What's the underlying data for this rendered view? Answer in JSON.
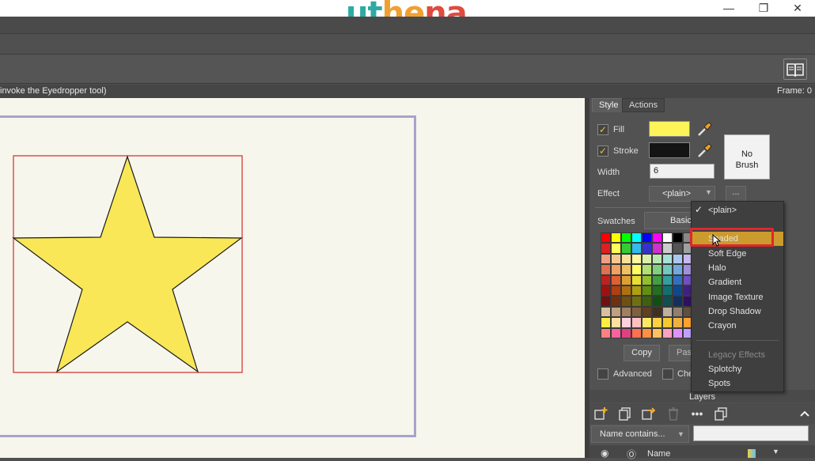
{
  "brand": {
    "logo_part1": "ut",
    "logo_part2": "he",
    "logo_part3": "na"
  },
  "window": {
    "minimize": "—",
    "restore": "❐",
    "close": "✕"
  },
  "status": {
    "message": "invoke the Eyedropper tool)",
    "frame": "Frame: 0"
  },
  "tabs": {
    "style": "Style",
    "actions": "Actions"
  },
  "style_panel": {
    "fill_label": "Fill",
    "fill_checked": true,
    "fill_color": "#fff35a",
    "stroke_label": "Stroke",
    "stroke_checked": true,
    "stroke_color": "#141414",
    "width_label": "Width",
    "width_value": "6",
    "effect_label": "Effect",
    "effect_value": "<plain>",
    "effect_more": "...",
    "brush_line1": "No",
    "brush_line2": "Brush",
    "swatches_label": "Swatches",
    "palette_value": "Basic",
    "copy_button": "Copy",
    "paste_button": "Paste",
    "advanced_label": "Advanced",
    "check_label": "Check"
  },
  "effect_menu": {
    "items": [
      "<plain>",
      "Shaded",
      "Soft Edge",
      "Halo",
      "Gradient",
      "Image Texture",
      "Drop Shadow",
      "Crayon",
      "Legacy Effects",
      "Splotchy",
      "Spots"
    ],
    "checked": "<plain>",
    "highlighted": "Shaded",
    "disabled": "Legacy Effects"
  },
  "layers": {
    "title": "Layers",
    "filter_value": "Name contains...",
    "column_name": "Name"
  },
  "canvas": {
    "star_fill": "#f9e758",
    "star_stroke": "#1a1a1a",
    "selection_color": "#d42a2a"
  },
  "swatch_colors": [
    "#ff0000",
    "#ffff00",
    "#00ff00",
    "#00ffff",
    "#0000ff",
    "#ff00ff",
    "#ffffff",
    "#000000",
    "#888888",
    "#dd2020",
    "#ffff55",
    "#33cc33",
    "#33bbee",
    "#3333cc",
    "#cc33cc",
    "#cccccc",
    "#555555",
    "#a0a0a0",
    "#f0a080",
    "#f5c890",
    "#f8e098",
    "#fff8a0",
    "#d8f0a8",
    "#b8e8b0",
    "#a8e0d8",
    "#a8c8f0",
    "#c8b8f0",
    "#e07050",
    "#f0a060",
    "#f0c060",
    "#ffff60",
    "#b0e070",
    "#80d080",
    "#70c8c0",
    "#70a8e0",
    "#a090e0",
    "#c02020",
    "#e06030",
    "#e0a030",
    "#e8e030",
    "#90c030",
    "#40a040",
    "#30a0a0",
    "#3070c0",
    "#7050c0",
    "#a01010",
    "#b04010",
    "#b07010",
    "#b0a010",
    "#609010",
    "#207020",
    "#107070",
    "#104890",
    "#402080",
    "#701010",
    "#703010",
    "#705010",
    "#707010",
    "#406010",
    "#105010",
    "#105050",
    "#103060",
    "#301060",
    "#d8c0a0",
    "#c0a080",
    "#a08060",
    "#806040",
    "#604020",
    "#403020",
    "#c0b0a0",
    "#908070",
    "#605040",
    "#ffee40",
    "#ffe0a0",
    "#ffd0e0",
    "#ffc0c0",
    "#ffe860",
    "#ffd040",
    "#f8c830",
    "#f0b040",
    "#ffa030",
    "#ff8080",
    "#ff60a0",
    "#e04080",
    "#ff7050",
    "#ff9040",
    "#ffc060",
    "#ffa0c0",
    "#e090ff",
    "#c0a0ff"
  ]
}
